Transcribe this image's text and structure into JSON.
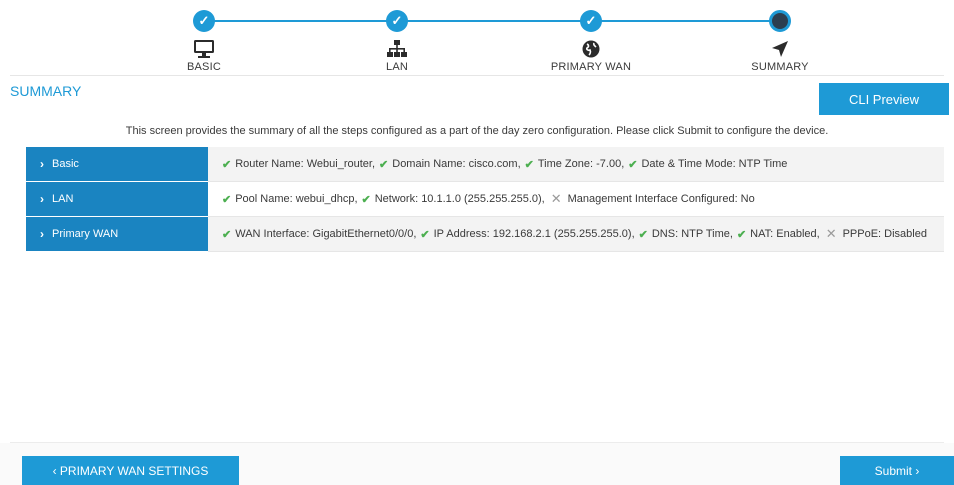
{
  "wizard": {
    "steps": [
      {
        "label": "BASIC",
        "status": "done",
        "icon": "monitor-icon"
      },
      {
        "label": "LAN",
        "status": "done",
        "icon": "network-icon"
      },
      {
        "label": "PRIMARY WAN",
        "status": "done",
        "icon": "globe-icon"
      },
      {
        "label": "SUMMARY",
        "status": "current",
        "icon": "navigation-arrow-icon"
      }
    ],
    "check_glyph": "✓"
  },
  "summary": {
    "title": "SUMMARY",
    "cli_preview_label": "CLI Preview",
    "description": "This screen provides the summary of all the steps configured as a part of the day zero configuration. Please click Submit to configure the device."
  },
  "rows": [
    {
      "key": "Basic",
      "items": [
        {
          "ok": true,
          "text": "Router Name: Webui_router,"
        },
        {
          "ok": true,
          "text": "Domain Name: cisco.com,"
        },
        {
          "ok": true,
          "text": "Time Zone: -7.00,"
        },
        {
          "ok": true,
          "text": "Date & Time Mode: NTP Time"
        }
      ]
    },
    {
      "key": "LAN",
      "items": [
        {
          "ok": true,
          "text": "Pool Name: webui_dhcp,"
        },
        {
          "ok": true,
          "text": "Network: 10.1.1.0 (255.255.255.0),"
        },
        {
          "ok": false,
          "text": "Management Interface Configured: No"
        }
      ]
    },
    {
      "key": "Primary WAN",
      "items": [
        {
          "ok": true,
          "text": "WAN Interface: GigabitEthernet0/0/0,"
        },
        {
          "ok": true,
          "text": "IP Address: 192.168.2.1 (255.255.255.0),"
        },
        {
          "ok": true,
          "text": "DNS: NTP Time,"
        },
        {
          "ok": true,
          "text": "NAT: Enabled,"
        },
        {
          "ok": false,
          "text": "PPPoE: Disabled"
        }
      ]
    }
  ],
  "footer": {
    "prev_label": "‹ PRIMARY WAN SETTINGS",
    "submit_label": "Submit ›"
  },
  "colors": {
    "accent": "#1e9ad6",
    "row_key": "#1a84c1",
    "ok": "#4caf50"
  }
}
